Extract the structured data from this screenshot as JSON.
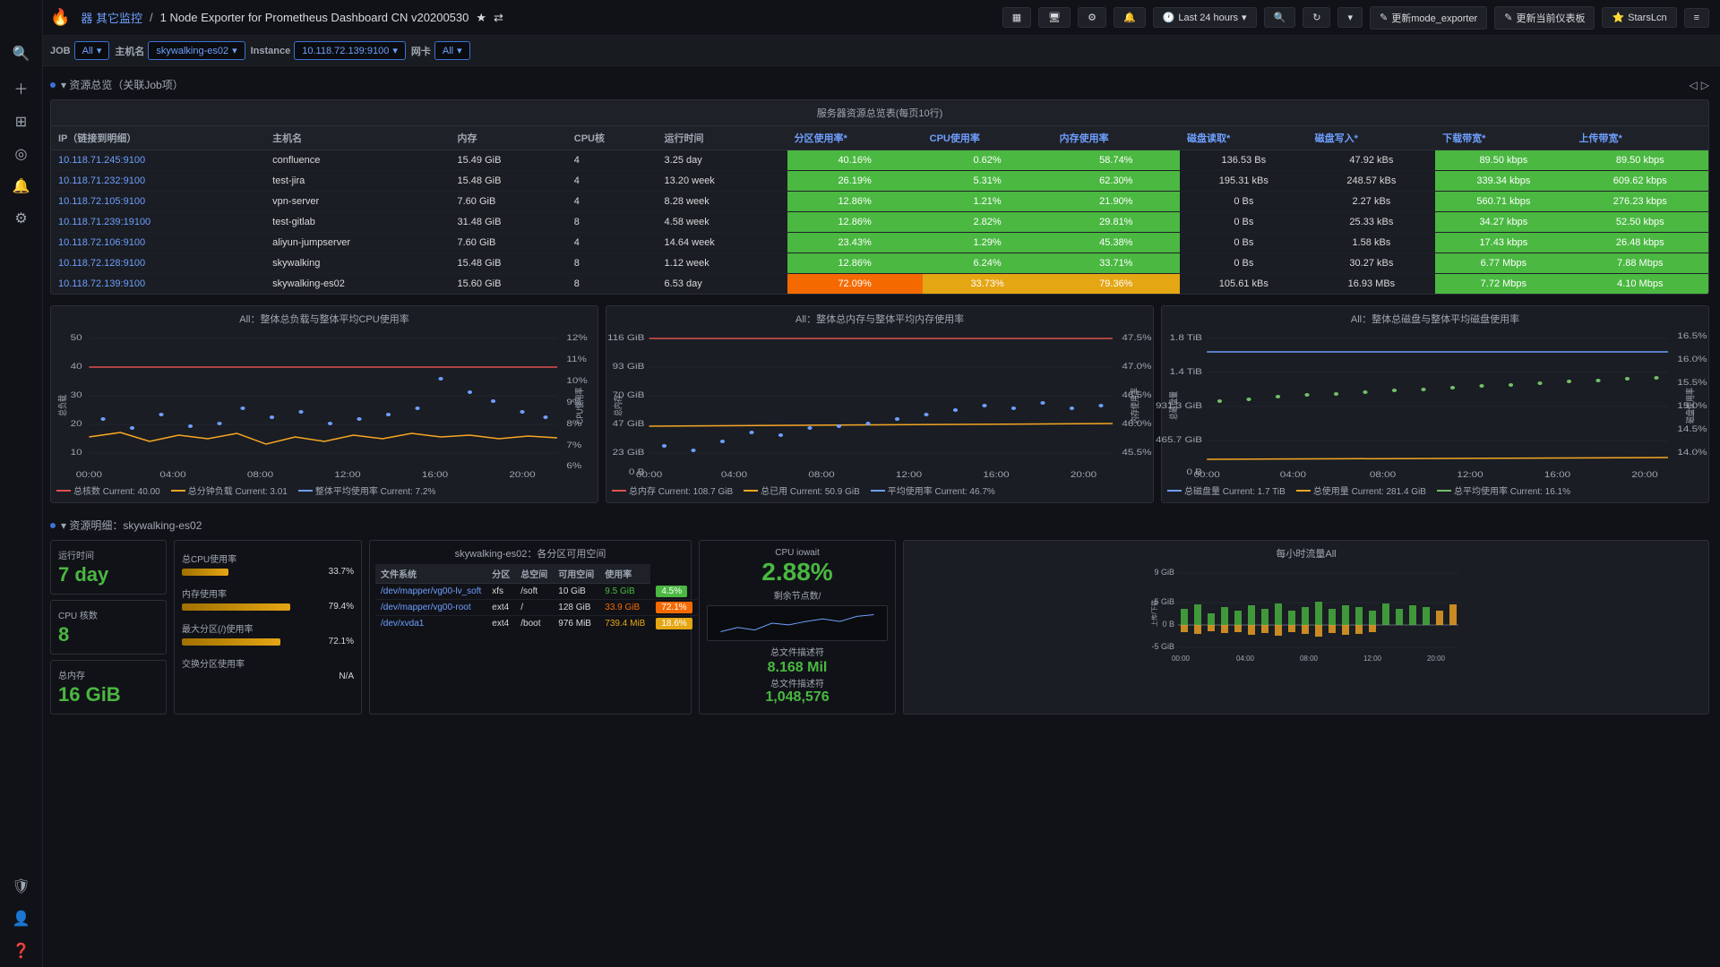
{
  "header": {
    "logo": "🔥",
    "breadcrumb_prefix": "器 其它监控",
    "separator": "/",
    "title": "1 Node Exporter for Prometheus Dashboard CN v20200530",
    "time_range": "Last 24 hours",
    "buttons": {
      "update_mode": "更新mode_exporter",
      "update_frontend": "更新当前仪表板",
      "stars": "StarsLcn"
    }
  },
  "toolbar": {
    "job_label": "JOB",
    "job_value": "All",
    "host_label": "主机名",
    "host_value": "skywalking-es02",
    "instance_label": "Instance",
    "instance_value": "10.118.72.139:9100",
    "network_label": "网卡",
    "network_value": "All"
  },
  "resource_overview": {
    "section_title": "▾ 资源总览（关联Job项）",
    "table_title": "服务器资源总览表(每页10行)",
    "columns": [
      "IP（链接到明细）",
      "主机名",
      "内存",
      "CPU核",
      "运行时间",
      "分区使用率*",
      "CPU使用率",
      "内存使用率",
      "磁盘读取*",
      "磁盘写入*",
      "下载带宽*",
      "上传带宽*"
    ],
    "rows": [
      {
        "ip": "10.118.71.245:9100",
        "hostname": "confluence",
        "memory": "15.49 GiB",
        "cpu": "4",
        "uptime": "3.25 day",
        "partition": "40.16%",
        "partition_color": "green",
        "cpu_usage": "0.62%",
        "cpu_color": "green",
        "mem_usage": "58.74%",
        "mem_color": "green",
        "disk_read": "136.53 Bs",
        "disk_write": "47.92 kBs",
        "dl_bw": "89.50 kbps",
        "ul_bw": "89.50 kbps",
        "bw_color": "green"
      },
      {
        "ip": "10.118.71.232:9100",
        "hostname": "test-jira",
        "memory": "15.48 GiB",
        "cpu": "4",
        "uptime": "13.20 week",
        "partition": "26.19%",
        "partition_color": "green",
        "cpu_usage": "5.31%",
        "cpu_color": "green",
        "mem_usage": "62.30%",
        "mem_color": "green",
        "disk_read": "195.31 kBs",
        "disk_write": "248.57 kBs",
        "dl_bw": "339.34 kbps",
        "ul_bw": "609.62 kbps",
        "bw_color": "green"
      },
      {
        "ip": "10.118.72.105:9100",
        "hostname": "vpn-server",
        "memory": "7.60 GiB",
        "cpu": "4",
        "uptime": "8.28 week",
        "partition": "12.86%",
        "partition_color": "green",
        "cpu_usage": "1.21%",
        "cpu_color": "green",
        "mem_usage": "21.90%",
        "mem_color": "green",
        "disk_read": "0 Bs",
        "disk_write": "2.27 kBs",
        "dl_bw": "560.71 kbps",
        "ul_bw": "276.23 kbps",
        "bw_color": "green"
      },
      {
        "ip": "10.118.71.239:19100",
        "hostname": "test-gitlab",
        "memory": "31.48 GiB",
        "cpu": "8",
        "uptime": "4.58 week",
        "partition": "12.86%",
        "partition_color": "green",
        "cpu_usage": "2.82%",
        "cpu_color": "green",
        "mem_usage": "29.81%",
        "mem_color": "green",
        "disk_read": "0 Bs",
        "disk_write": "25.33 kBs",
        "dl_bw": "34.27 kbps",
        "ul_bw": "52.50 kbps",
        "bw_color": "green"
      },
      {
        "ip": "10.118.72.106:9100",
        "hostname": "aliyun-jumpserver",
        "memory": "7.60 GiB",
        "cpu": "4",
        "uptime": "14.64 week",
        "partition": "23.43%",
        "partition_color": "green",
        "cpu_usage": "1.29%",
        "cpu_color": "green",
        "mem_usage": "45.38%",
        "mem_color": "green",
        "disk_read": "0 Bs",
        "disk_write": "1.58 kBs",
        "dl_bw": "17.43 kbps",
        "ul_bw": "26.48 kbps",
        "bw_color": "green"
      },
      {
        "ip": "10.118.72.128:9100",
        "hostname": "skywalking",
        "memory": "15.48 GiB",
        "cpu": "8",
        "uptime": "1.12 week",
        "partition": "12.86%",
        "partition_color": "green",
        "cpu_usage": "6.24%",
        "cpu_color": "green",
        "mem_usage": "33.71%",
        "mem_color": "green",
        "disk_read": "0 Bs",
        "disk_write": "30.27 kBs",
        "dl_bw": "6.77 Mbps",
        "ul_bw": "7.88 Mbps",
        "bw_color": "green"
      },
      {
        "ip": "10.118.72.139:9100",
        "hostname": "skywalking-es02",
        "memory": "15.60 GiB",
        "cpu": "8",
        "uptime": "6.53 day",
        "partition": "72.09%",
        "partition_color": "orange",
        "cpu_usage": "33.73%",
        "cpu_color": "yellow",
        "mem_usage": "79.36%",
        "mem_color": "orange",
        "disk_read": "105.61 kBs",
        "disk_write": "16.93 MBs",
        "dl_bw": "7.72 Mbps",
        "ul_bw": "4.10 Mbps",
        "bw_color": "green"
      }
    ]
  },
  "charts": {
    "cpu_chart": {
      "title": "All：整体总负载与整体平均CPU使用率",
      "y_left_max": "50",
      "y_left_values": [
        "50",
        "40",
        "30",
        "20",
        "10"
      ],
      "y_right_max": "12%",
      "y_right_values": [
        "12%",
        "11%",
        "10%",
        "9%",
        "8%",
        "7%",
        "6%"
      ],
      "x_labels": [
        "00:00",
        "04:00",
        "08:00",
        "12:00",
        "16:00",
        "20:00"
      ],
      "legend": [
        {
          "label": "总核数  Current: 40.00",
          "color": "#e05050"
        },
        {
          "label": "总分钟负载  Current: 3.01",
          "color": "#f5a623"
        },
        {
          "label": "整体平均使用率  Current: 7.2%",
          "color": "#6e9fff"
        }
      ]
    },
    "mem_chart": {
      "title": "All：整体总内存与整体平均内存使用率",
      "y_left_values": [
        "116 GiB",
        "93 GiB",
        "70 GiB",
        "47 GiB",
        "23 GiB",
        "0 B"
      ],
      "y_right_values": [
        "47.5%",
        "47.0%",
        "46.5%",
        "46.0%",
        "45.5%"
      ],
      "x_labels": [
        "00:00",
        "04:00",
        "08:00",
        "12:00",
        "16:00",
        "20:00"
      ],
      "legend": [
        {
          "label": "总内存  Current: 108.7 GiB",
          "color": "#e05050"
        },
        {
          "label": "总已用  Current: 50.9 GiB",
          "color": "#f5a623"
        },
        {
          "label": "平均使用率  Current: 46.7%",
          "color": "#6e9fff"
        }
      ]
    },
    "disk_chart": {
      "title": "All：整体总磁盘与整体平均磁盘使用率",
      "y_left_values": [
        "1.8 TiB",
        "1.4 TiB",
        "931.3 GiB",
        "465.7 GiB",
        "0 B"
      ],
      "y_right_values": [
        "16.5%",
        "16.0%",
        "15.5%",
        "15.0%",
        "14.5%",
        "14.0%"
      ],
      "x_labels": [
        "00:00",
        "04:00",
        "08:00",
        "12:00",
        "16:00",
        "20:00"
      ],
      "legend": [
        {
          "label": "总磁盘量  Current: 1.7 TiB",
          "color": "#6e9fff"
        },
        {
          "label": "总使用量  Current: 281.4 GiB",
          "color": "#f5a623"
        },
        {
          "label": "总平均使用率  Current: 16.1%",
          "color": "#73bf69"
        }
      ]
    }
  },
  "resource_detail": {
    "section_title": "▾ 资源明细：skywalking-es02",
    "uptime_label": "运行时间",
    "uptime_value": "7 day",
    "cpu_cores_label": "CPU 核数",
    "cpu_cores_value": "8",
    "memory_label": "总内存",
    "memory_value": "16 GiB",
    "cpu_usage_label": "总CPU使用率",
    "cpu_usage_value": "33.7%",
    "mem_usage_label": "内存使用率",
    "mem_usage_value": "79.4%",
    "partition_label": "最大分区(/)使用率",
    "partition_value": "72.1%",
    "swap_label": "交换分区使用率",
    "swap_value": "N/A",
    "disk_table": {
      "title": "skywalking-es02：各分区可用空间",
      "columns": [
        "文件系统",
        "分区",
        "总空间",
        "可用空间",
        "使用率"
      ],
      "rows": [
        {
          "fs": "/dev/mapper/vg00-lv_soft",
          "partition": "xfs",
          "mount": "/soft",
          "total": "10 GiB",
          "avail": "9.5 GiB",
          "usage": "4.5%",
          "color": "green"
        },
        {
          "fs": "/dev/mapper/vg00-root",
          "partition": "ext4",
          "mount": "/",
          "total": "128 GiB",
          "avail": "33.9 GiB",
          "usage": "72.1%",
          "color": "orange"
        },
        {
          "fs": "/dev/xvda1",
          "partition": "ext4",
          "mount": "/boot",
          "total": "976 MiB",
          "avail": "739.4 MiB",
          "usage": "18.6%",
          "color": "yellow"
        }
      ]
    },
    "iowait": {
      "label": "CPU iowait",
      "value": "2.88%",
      "sub_label": "剩余节点数/",
      "sub_value": "8.168 Mil",
      "files_label": "总文件描述符",
      "files_value": "1,048,576"
    },
    "traffic_title": "每小时流量All"
  }
}
